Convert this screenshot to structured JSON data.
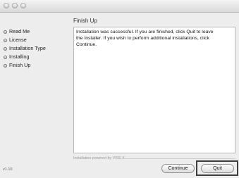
{
  "sidebar": {
    "steps": [
      {
        "label": "Read Me"
      },
      {
        "label": "License"
      },
      {
        "label": "Installation Type"
      },
      {
        "label": "Installing"
      },
      {
        "label": "Finish Up"
      }
    ]
  },
  "version": "v1.10",
  "main": {
    "heading": "Finish Up",
    "message_line1": "Installation was successful. If you are finished, click Quit to leave",
    "message_line2": "the Installer. If you wish to perform additional installations, click",
    "message_line3": "Continue."
  },
  "footer": {
    "powered_by": "Installation powered by VISE X",
    "continue_label": "Continue",
    "quit_label": "Quit"
  }
}
